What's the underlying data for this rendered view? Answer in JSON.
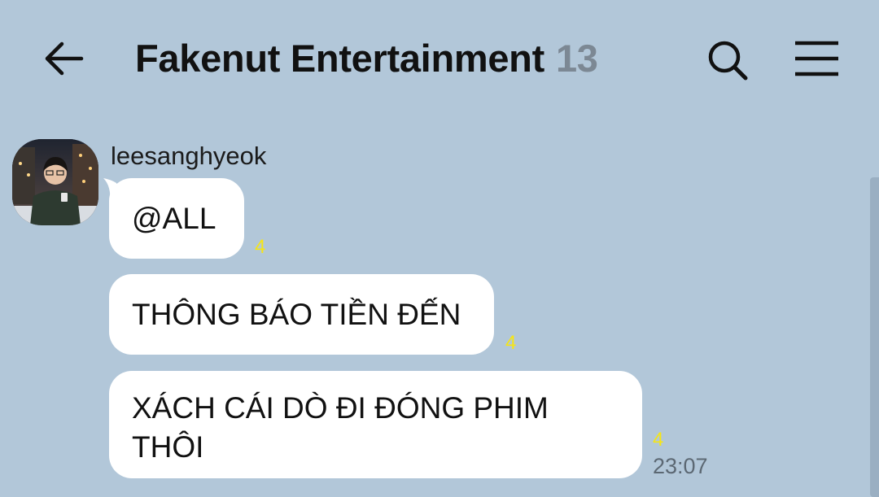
{
  "header": {
    "title": "Fakenut Entertainment",
    "member_count": "13",
    "back_icon": "arrow-left-icon",
    "search_icon": "search-icon",
    "menu_icon": "hamburger-menu-icon"
  },
  "message_group": {
    "sender": "leesanghyeok",
    "messages": [
      {
        "text": "@ALL",
        "unread": "4"
      },
      {
        "text": "THÔNG BÁO TIỀN ĐẾN",
        "unread": "4"
      },
      {
        "line1": "XÁCH CÁI DÒ ĐI ĐÓNG PHIM",
        "line2": "THÔI",
        "unread": "4",
        "time": "23:07"
      }
    ]
  },
  "colors": {
    "background": "#b2c7d9",
    "bubble": "#ffffff",
    "unread": "#f6e516",
    "count": "#7c8894"
  }
}
